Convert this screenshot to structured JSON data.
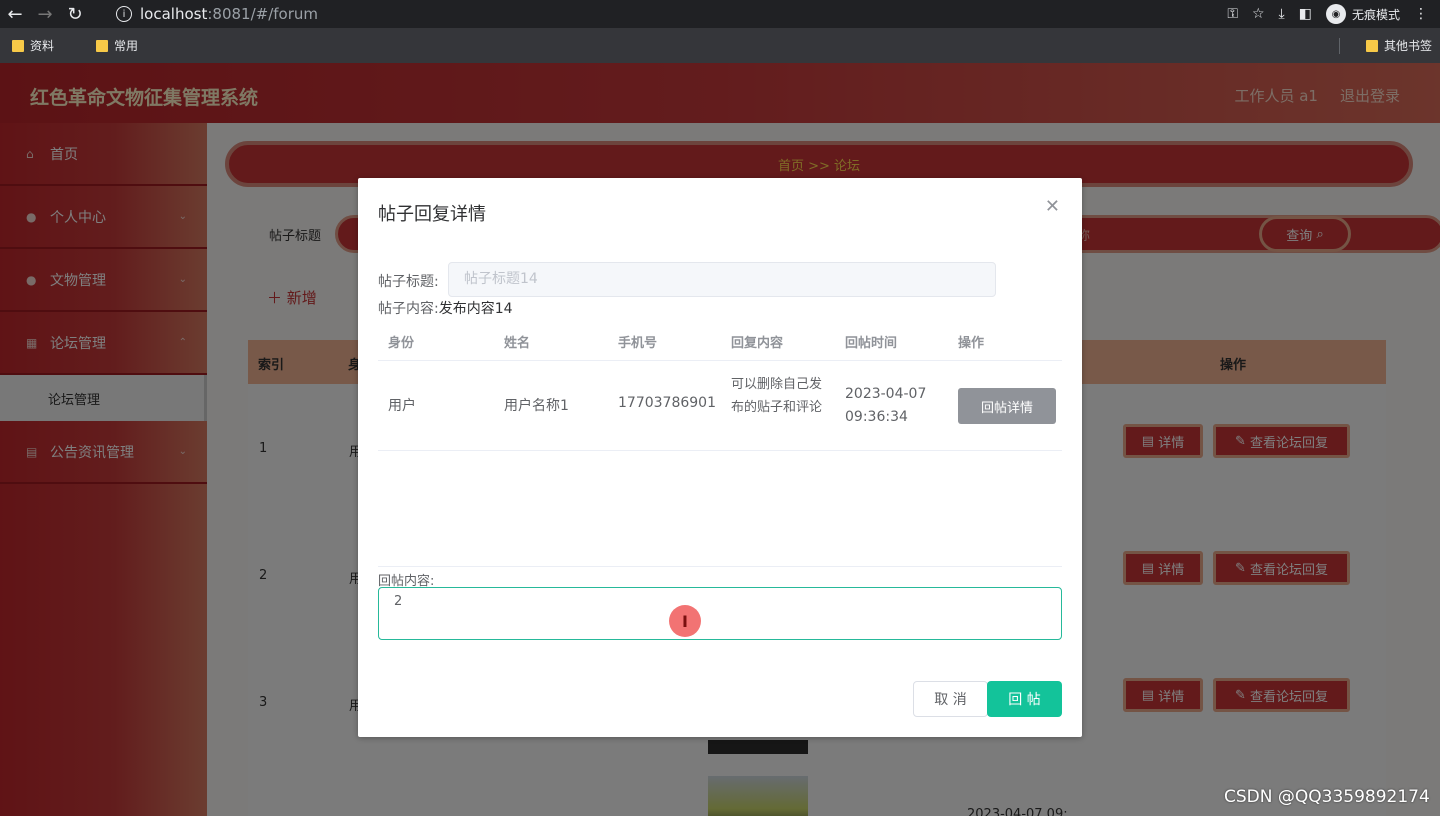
{
  "browser": {
    "url_host": "localhost",
    "url_path": ":8081/#/forum",
    "incognito_label": "无痕模式",
    "bookmarks": [
      "资料",
      "常用"
    ],
    "other_bookmarks": "其他书签",
    "icons": [
      "back-icon",
      "forward-icon",
      "reload-icon",
      "key-icon",
      "star-icon",
      "download-icon",
      "sidebar-icon",
      "menu-icon"
    ]
  },
  "header": {
    "title": "红色革命文物征集管理系统",
    "user": "工作人员 a1",
    "logout": "退出登录"
  },
  "sidebar": {
    "items": [
      {
        "label": "首页",
        "icon": "home-icon"
      },
      {
        "label": "个人中心",
        "icon": "user-icon"
      },
      {
        "label": "文物管理",
        "icon": "person-icon"
      },
      {
        "label": "论坛管理",
        "icon": "grid-icon"
      },
      {
        "label": "公告资讯管理",
        "icon": "briefcase-icon"
      }
    ],
    "sub_item": "论坛管理"
  },
  "main": {
    "breadcrumb": "首页 >> 论坛",
    "search_label": "帖子标题",
    "search_hint": "称",
    "query_btn": "查询",
    "add_btn": "新增",
    "table": {
      "col_index": "索引",
      "col_partial": "身",
      "col_ops": "操作",
      "rows": [
        {
          "idx": "1",
          "partial": "用"
        },
        {
          "idx": "2",
          "partial": "用"
        },
        {
          "idx": "3",
          "partial": "用"
        }
      ],
      "detail_btn": "详情",
      "view_reply_btn": "查看论坛回复",
      "truncated_date": "2023-04-07 09:"
    }
  },
  "dialog": {
    "title": "帖子回复详情",
    "title_label": "帖子标题:",
    "title_value": "帖子标题14",
    "content_label": "帖子内容:",
    "content_value": "发布内容14",
    "reply_table": {
      "headers": [
        "身份",
        "姓名",
        "手机号",
        "回复内容",
        "回帖时间",
        "操作"
      ],
      "rows": [
        {
          "identity": "用户",
          "name": "用户名称1",
          "phone": "17703786901",
          "content": "可以删除自己发布的贴子和评论",
          "time": "2023-04-07 09:36:34",
          "action": "回帖详情"
        }
      ]
    },
    "reply_label": "回帖内容:",
    "reply_value": "2",
    "cancel": "取 消",
    "confirm": "回 帖"
  },
  "watermark": "CSDN @QQ3359892174",
  "colors": {
    "primary_red": "#c63436",
    "accent_green": "#13c39a",
    "gold": "#ffd84d"
  }
}
